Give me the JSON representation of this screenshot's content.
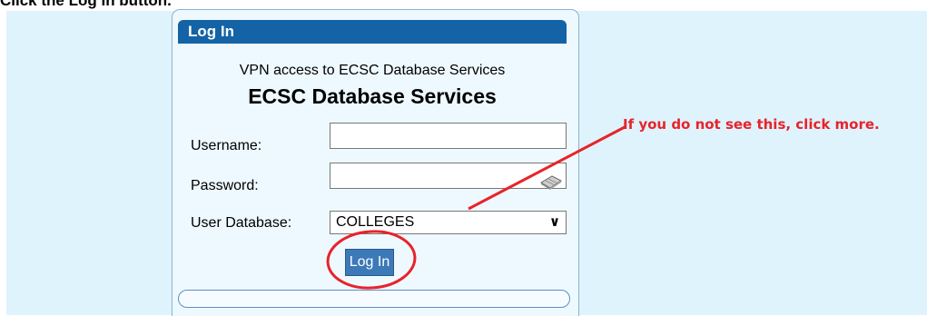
{
  "instruction": {
    "prefix": "Click the ",
    "emphasis": "Log In",
    "suffix": " button."
  },
  "panel": {
    "header": "Log In",
    "subtitle": "VPN access to ECSC Database Services",
    "service_title": "ECSC Database Services"
  },
  "form": {
    "username_label": "Username:",
    "username_value": "",
    "password_label": "Password:",
    "password_value": "",
    "database_label": "User Database:",
    "database_value": "COLLEGES",
    "submit_label": "Log In"
  },
  "annotation": {
    "text": "If you do not see this, click more.",
    "color": "#e8232a"
  },
  "colors": {
    "header_bg": "#1363a6",
    "button_bg": "#3c79b8",
    "backdrop": "#dff3fd",
    "panel_bg": "#eef9ff"
  },
  "icons": {
    "keyboard": "keyboard-icon",
    "dropdown": "chevron-down-icon"
  }
}
